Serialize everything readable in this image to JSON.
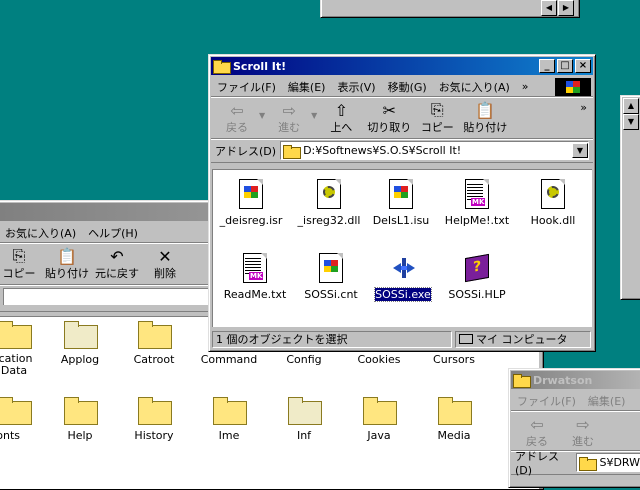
{
  "top_window": {
    "left_btn": "◀",
    "right_btn": "▶"
  },
  "left_window": {
    "menu": [
      "お気に入り(A)",
      "ヘルプ(H)"
    ],
    "toolbar": [
      {
        "label": "コピー",
        "icon": "copy-icon"
      },
      {
        "label": "貼り付け",
        "icon": "paste-icon"
      },
      {
        "label": "元に戻す",
        "icon": "undo-icon"
      },
      {
        "label": "削除",
        "icon": "delete-icon"
      }
    ],
    "folders": [
      {
        "name": "ication\nData"
      },
      {
        "name": "Applog"
      },
      {
        "name": "Catroot"
      },
      {
        "name": "Command"
      },
      {
        "name": "Config"
      },
      {
        "name": "Cookies"
      },
      {
        "name": "Cursors"
      },
      {
        "name": "onts"
      },
      {
        "name": "Help"
      },
      {
        "name": "History"
      },
      {
        "name": "Ime"
      },
      {
        "name": "Inf"
      },
      {
        "name": "Java"
      },
      {
        "name": "Media"
      }
    ]
  },
  "scroll_window": {
    "title": "Scroll It!",
    "menu": [
      "ファイル(F)",
      "編集(E)",
      "表示(V)",
      "移動(G)",
      "お気に入り(A)"
    ],
    "menu_more": "»",
    "toolbar": [
      {
        "label": "戻る",
        "icon": "back-arrow-icon",
        "disabled": true
      },
      {
        "label": "進む",
        "icon": "forward-arrow-icon",
        "disabled": true
      },
      {
        "label": "上へ",
        "icon": "up-folder-icon",
        "disabled": false
      },
      {
        "label": "切り取り",
        "icon": "cut-icon",
        "disabled": false
      },
      {
        "label": "コピー",
        "icon": "copy-icon",
        "disabled": false
      },
      {
        "label": "貼り付け",
        "icon": "paste-icon",
        "disabled": false
      }
    ],
    "address_label": "アドレス(D)",
    "address_value": "D:¥Softnews¥S.O.S¥Scroll It!",
    "files": [
      {
        "name": "_deisreg.isr",
        "icon": "installer-icon"
      },
      {
        "name": "_isreg32.dll",
        "icon": "dll-gear-icon"
      },
      {
        "name": "DeIsL1.isu",
        "icon": "installer-icon"
      },
      {
        "name": "HelpMe!.txt",
        "icon": "text-file-icon"
      },
      {
        "name": "Hook.dll",
        "icon": "dll-gear-icon"
      },
      {
        "name": "ReadMe.txt",
        "icon": "text-file-icon"
      },
      {
        "name": "SOSSi.cnt",
        "icon": "installer-icon"
      },
      {
        "name": "SOSSi.exe",
        "icon": "scroll-exe-icon",
        "selected": true
      },
      {
        "name": "SOSSi.HLP",
        "icon": "help-book-icon"
      }
    ],
    "status_left": "1 個のオブジェクトを選択",
    "status_right": "マイ コンピュータ"
  },
  "drwatson_window": {
    "title": "Drwatson",
    "menu": [
      "ファイル(F)",
      "編集(E)"
    ],
    "toolbar": [
      {
        "label": "戻る",
        "icon": "back-arrow-icon"
      },
      {
        "label": "進む",
        "icon": "forward-arrow-icon"
      }
    ],
    "address_label": "アドレス(D)",
    "address_value": "S¥DRW"
  },
  "colors": {
    "desktop": "#008080",
    "title_active": "#000080",
    "selection": "#000080"
  }
}
